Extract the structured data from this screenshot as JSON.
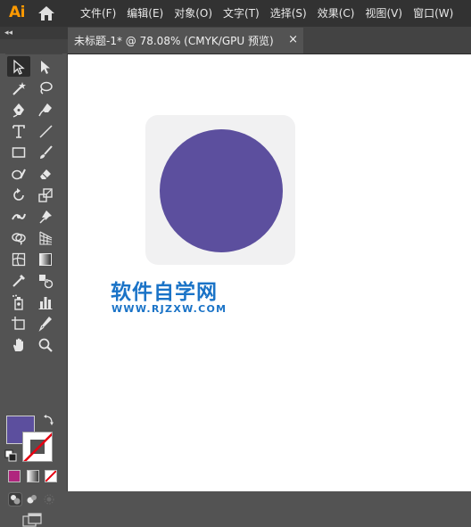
{
  "app": {
    "logo": "Ai"
  },
  "menu": {
    "items": [
      {
        "label": "文件(F)"
      },
      {
        "label": "编辑(E)"
      },
      {
        "label": "对象(O)"
      },
      {
        "label": "文字(T)"
      },
      {
        "label": "选择(S)"
      },
      {
        "label": "效果(C)"
      },
      {
        "label": "视图(V)"
      },
      {
        "label": "窗口(W)"
      }
    ]
  },
  "panel": {
    "collapse_label": "◂◂"
  },
  "document_tab": {
    "title": "未标题-1* @ 78.08% (CMYK/GPU 预览)",
    "close_label": "×"
  },
  "colors": {
    "fill": "#5c4f9e",
    "stroke": "none",
    "shape_background": "#f1f1f2",
    "accent_logo": "#ff9a00",
    "watermark": "#1a73c7"
  },
  "watermark": {
    "title": "软件自学网",
    "url": "WWW.RJZXW.COM"
  }
}
